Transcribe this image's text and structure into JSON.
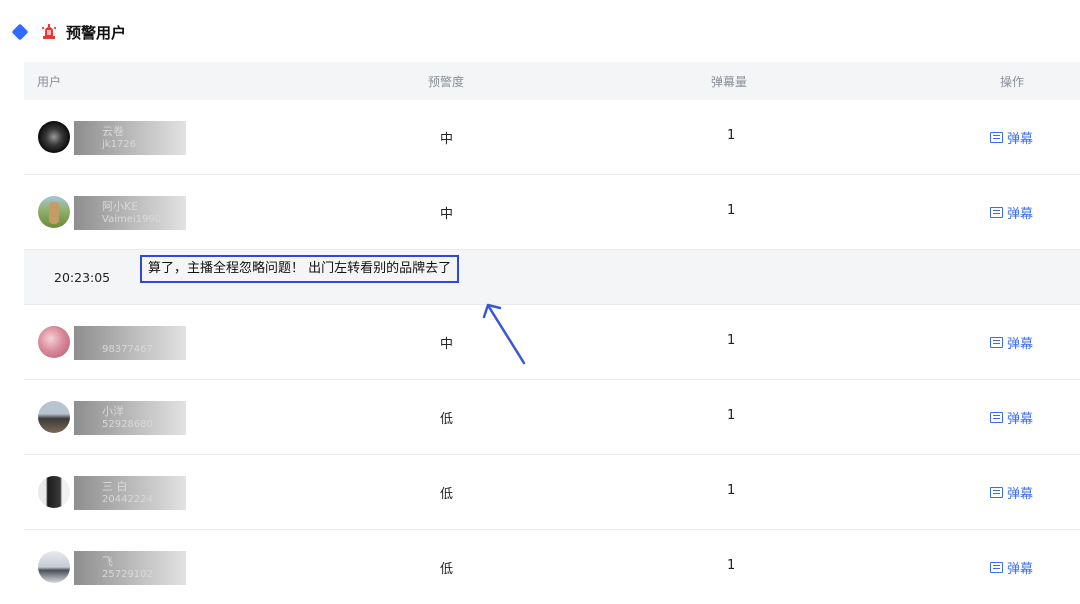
{
  "header": {
    "title": "预警用户",
    "diamond_color": "#2f6bff",
    "alarm_color": "#e53935"
  },
  "table": {
    "headers": {
      "user": "用户",
      "level": "预警度",
      "count": "弹幕量",
      "op": "操作"
    },
    "rows": [
      {
        "name": "云卷",
        "uid": "jk1726",
        "level": "中",
        "count": "1",
        "op_label": "弹幕",
        "avatar": "dark-swirl"
      },
      {
        "name": "阿小KE",
        "uid": "Vaimei1990",
        "level": "中",
        "count": "1",
        "op_label": "弹幕",
        "avatar": "outdoor-person"
      },
      {
        "name": "",
        "uid": "98377467",
        "level": "中",
        "count": "1",
        "op_label": "弹幕",
        "avatar": "pink-photo"
      },
      {
        "name": "小洋",
        "uid": "52928680",
        "level": "低",
        "count": "1",
        "op_label": "弹幕",
        "avatar": "landscape"
      },
      {
        "name": "三 白",
        "uid": "20442224",
        "level": "低",
        "count": "1",
        "op_label": "弹幕",
        "avatar": "person-dark"
      },
      {
        "name": "飞",
        "uid": "25729102",
        "level": "低",
        "count": "1",
        "op_label": "弹幕",
        "avatar": "car-scene"
      }
    ],
    "detail": {
      "time": "20:23:05",
      "message": "算了，主播全程忽略问题！ 出门左转看别的品牌去了"
    }
  },
  "accent_color": "#3a6df0",
  "highlight_color": "#2f49d6"
}
